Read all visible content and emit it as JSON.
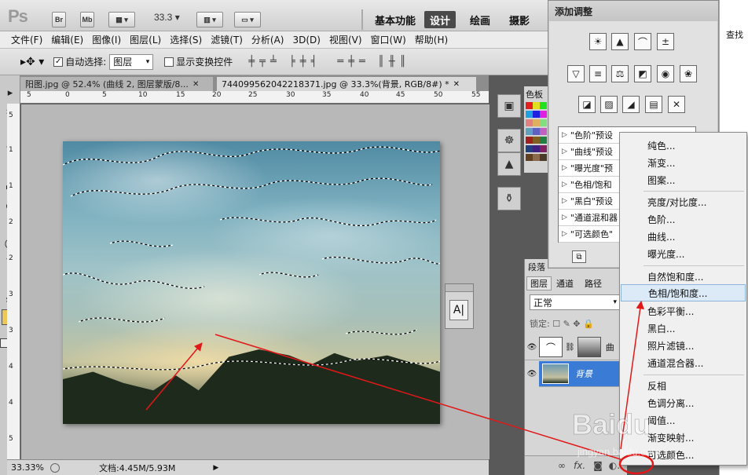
{
  "app": {
    "logo": "Ps",
    "br": "Br",
    "mb": "Mb",
    "zoom": "33.3"
  },
  "workspaces": [
    "基本功能",
    "设计",
    "绘画",
    "摄影"
  ],
  "active_workspace": "设计",
  "menu": [
    "文件(F)",
    "编辑(E)",
    "图像(I)",
    "图层(L)",
    "选择(S)",
    "滤镜(T)",
    "分析(A)",
    "3D(D)",
    "视图(V)",
    "窗口(W)",
    "帮助(H)"
  ],
  "options": {
    "auto_select_label": "自动选择:",
    "auto_select_value": "图层",
    "show_transform_label": "显示变换控件"
  },
  "tabs": [
    {
      "label": "阳图.jpg @ 52.4% (曲线 2, 图层蒙版/8...",
      "active": false
    },
    {
      "label": "744099562042218371.jpg @ 33.3%(背景, RGB/8#) *",
      "active": true
    }
  ],
  "ruler_top": [
    "5",
    "0",
    "5",
    "10",
    "15",
    "20",
    "25",
    "30",
    "35",
    "40",
    "45",
    "50",
    "55"
  ],
  "ruler_left": [
    "5",
    "1",
    "1",
    "2",
    "2",
    "3",
    "3",
    "4",
    "4",
    "5"
  ],
  "status": {
    "zoom": "33.33%",
    "doc": "文档:4.45M/5.93M"
  },
  "char_panel": {
    "glyph": "A|"
  },
  "color_panel": {
    "title": "色板"
  },
  "adjustments": {
    "title": "添加调整",
    "presets": [
      "\"色阶\"预设",
      "\"曲线\"预设",
      "\"曝光度\"预",
      "\"色相/饱和",
      "\"黑白\"预设",
      "\"通道混和器",
      "\"可选颜色\""
    ]
  },
  "layers": {
    "tabs": [
      "图层",
      "通道",
      "路径"
    ],
    "top_tab": "段落",
    "blend_mode": "正常",
    "lock_label": "锁定:",
    "rows": [
      {
        "name": "曲"
      },
      {
        "name": "背景"
      }
    ]
  },
  "context_menu": {
    "groups": [
      [
        "纯色...",
        "渐变...",
        "图案..."
      ],
      [
        "亮度/对比度...",
        "色阶...",
        "曲线...",
        "曝光度..."
      ],
      [
        "自然饱和度...",
        "色相/饱和度...",
        "色彩平衡...",
        "黑白...",
        "照片滤镜...",
        "通道混合器..."
      ],
      [
        "反相",
        "色调分离...",
        "阈值...",
        "渐变映射...",
        "可选颜色..."
      ]
    ],
    "highlighted": "色相/饱和度..."
  },
  "far_right": {
    "text": "查找"
  },
  "watermark": {
    "brand": "Baidu",
    "sub": "jingyan.baidu.com"
  },
  "colors": {
    "accent_red": "#e01818",
    "highlight": "#dce9f6"
  }
}
